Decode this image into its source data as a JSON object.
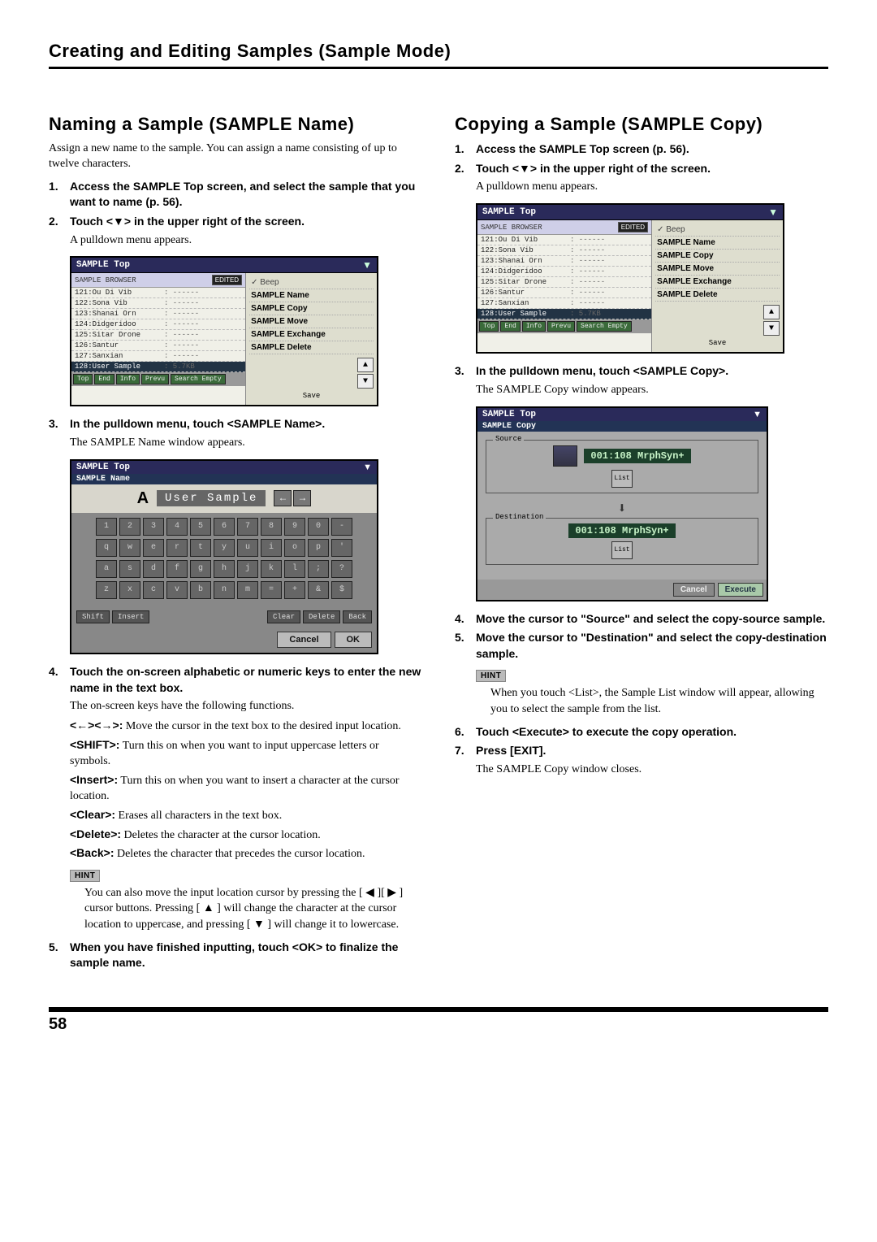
{
  "header": {
    "title": "Creating and Editing Samples (Sample Mode)"
  },
  "pagenum": "58",
  "left": {
    "h2": "Naming a Sample (SAMPLE Name)",
    "lead": "Assign a new name to the sample. You can assign a name consisting of up to twelve characters.",
    "step1": "Access the SAMPLE Top screen, and select the sample that you want to name (p. 56).",
    "step2": "Touch <▼> in the upper right of the screen.",
    "step2_sub": "A pulldown menu appears.",
    "shot1": {
      "title": "SAMPLE Top",
      "browserlabel": "SAMPLE BROWSER",
      "edited": "EDITED",
      "rows": [
        {
          "id": "121:Ou Di Vib",
          "sz": ": ------"
        },
        {
          "id": "122:Sona Vib",
          "sz": ": ------"
        },
        {
          "id": "123:Shanai Orn",
          "sz": ": ------"
        },
        {
          "id": "124:Didgeridoo",
          "sz": ": ------"
        },
        {
          "id": "125:Sitar Drone",
          "sz": ": ------"
        },
        {
          "id": "126:Santur",
          "sz": ": ------"
        },
        {
          "id": "127:Sanxian",
          "sz": ": ------"
        },
        {
          "id": "128:User Sample",
          "sz": ": 5.7KB",
          "sel": true
        }
      ],
      "footer_btns": [
        "Top",
        "End",
        "Info",
        "Prevu",
        "Search Empty"
      ],
      "menu": {
        "beep": "✓ Beep",
        "items": [
          "SAMPLE Name",
          "SAMPLE Copy",
          "SAMPLE Move",
          "SAMPLE Exchange",
          "SAMPLE Delete"
        ],
        "save": "Save"
      }
    },
    "step3": "In the pulldown menu, touch <SAMPLE Name>.",
    "step3_sub": "The SAMPLE Name window appears.",
    "shot2": {
      "title": "SAMPLE Top",
      "sub": "SAMPLE Name",
      "aa": "A",
      "text": "User Sample",
      "navL": "←",
      "navR": "→",
      "rows": [
        [
          "1",
          "2",
          "3",
          "4",
          "5",
          "6",
          "7",
          "8",
          "9",
          "0",
          "-"
        ],
        [
          "q",
          "w",
          "e",
          "r",
          "t",
          "y",
          "u",
          "i",
          "o",
          "p",
          "'"
        ],
        [
          "a",
          "s",
          "d",
          "f",
          "g",
          "h",
          "j",
          "k",
          "l",
          ";",
          "?"
        ],
        [
          "z",
          "x",
          "c",
          "v",
          "b",
          "n",
          "m",
          "=",
          "+",
          "&",
          "$"
        ]
      ],
      "ctrls": {
        "shift": "Shift",
        "insert": "Insert",
        "clear": "Clear",
        "delete": "Delete",
        "back": "Back"
      },
      "cancel": "Cancel",
      "ok": "OK"
    },
    "step4": "Touch the on-screen alphabetic or numeric keys to enter the new name in the text box.",
    "step4_text": "The on-screen keys have the following functions.",
    "keys": {
      "arrows_label": "<←><→>:",
      "arrows_text": " Move the cursor in the text box to the desired input location.",
      "shift_label": "<SHIFT>:",
      "shift_text": " Turn this on when you want to input uppercase letters or symbols.",
      "insert_label": "<Insert>:",
      "insert_text": " Turn this on when you want to insert a character at the cursor location.",
      "clear_label": "<Clear>:",
      "clear_text": " Erases all characters in the text box.",
      "delete_label": "<Delete>:",
      "delete_text": " Deletes the character at the cursor location.",
      "back_label": "<Back>:",
      "back_text": " Deletes the character that precedes the cursor location."
    },
    "hint_label": "HINT",
    "hint_text": "You can also move the input location cursor by pressing the [ ◀ ][ ▶ ] cursor buttons. Pressing [ ▲ ] will change the character at the cursor location to uppercase, and pressing [ ▼ ] will change it to lowercase.",
    "step5": "When you have finished inputting, touch <OK> to finalize the sample name."
  },
  "right": {
    "h2": "Copying a Sample (SAMPLE Copy)",
    "step1": "Access the SAMPLE Top screen (p. 56).",
    "step2": "Touch <▼> in the upper right of the screen.",
    "step2_sub": "A pulldown menu appears.",
    "shot1": {
      "title": "SAMPLE Top",
      "browserlabel": "SAMPLE BROWSER",
      "edited": "EDITED",
      "rows": [
        {
          "id": "121:Ou Di Vib",
          "sz": ": ------"
        },
        {
          "id": "122:Sona Vib",
          "sz": ": ------"
        },
        {
          "id": "123:Shanai Orn",
          "sz": ": ------"
        },
        {
          "id": "124:Didgeridoo",
          "sz": ": ------"
        },
        {
          "id": "125:Sitar Drone",
          "sz": ": ------"
        },
        {
          "id": "126:Santur",
          "sz": ": ------"
        },
        {
          "id": "127:Sanxian",
          "sz": ": ------"
        },
        {
          "id": "128:User Sample",
          "sz": ": 5.7KB",
          "sel": true
        }
      ],
      "footer_btns": [
        "Top",
        "End",
        "Info",
        "Prevu",
        "Search Empty"
      ],
      "menu": {
        "beep": "✓ Beep",
        "items": [
          "SAMPLE Name",
          "SAMPLE Copy",
          "SAMPLE Move",
          "SAMPLE Exchange",
          "SAMPLE Delete"
        ],
        "save": "Save"
      }
    },
    "step3": "In the pulldown menu, touch <SAMPLE Copy>.",
    "step3_sub": "The SAMPLE Copy window appears.",
    "shot2": {
      "title": "SAMPLE Top",
      "sub": "SAMPLE Copy",
      "srclabel": "Source",
      "dstlabel": "Destination",
      "src": "001:108 MrphSyn+",
      "dst": "001:108 MrphSyn+",
      "list": "List",
      "cancel": "Cancel",
      "execute": "Execute"
    },
    "step4": "Move the cursor to \"Source\" and select the copy-source sample.",
    "step5": "Move the cursor to \"Destination\" and select the copy-destination sample.",
    "hint_label": "HINT",
    "hint_text": "When you touch <List>, the Sample List window will appear, allowing you to select the sample from the list.",
    "step6": "Touch <Execute> to execute the copy operation.",
    "step7": "Press [EXIT].",
    "step7_sub": "The SAMPLE Copy window closes."
  }
}
